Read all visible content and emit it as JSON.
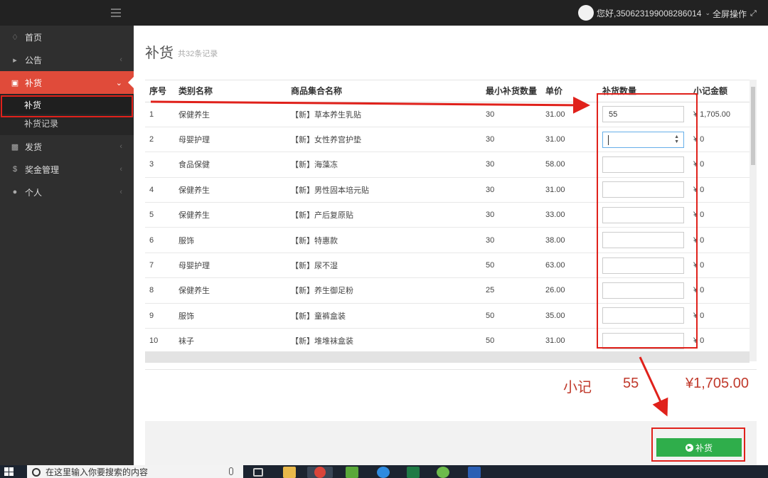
{
  "topbar": {
    "user_greeting": "您好,350623199008286014",
    "fullscreen_label": "全屏操作"
  },
  "sidebar": {
    "items": [
      {
        "label": "首页",
        "icon": "diamond-icon"
      },
      {
        "label": "公告",
        "icon": "bullhorn-icon"
      },
      {
        "label": "补货",
        "icon": "cart-icon",
        "active": true
      },
      {
        "label": "发货",
        "icon": "truck-icon"
      },
      {
        "label": "奖金管理",
        "icon": "dollar-icon"
      },
      {
        "label": "个人",
        "icon": "user-icon"
      }
    ],
    "sub_items": [
      {
        "label": "补货",
        "selected": true
      },
      {
        "label": "补货记录"
      }
    ]
  },
  "page": {
    "title": "补货",
    "count": "共32条记录"
  },
  "table": {
    "headers": [
      "序号",
      "类别名称",
      "商品集合名称",
      "最小补货数量",
      "单价",
      "补货数量",
      "小记金额"
    ],
    "rows": [
      {
        "no": "1",
        "category": "保健养生",
        "product": "【新】草本养生乳贴",
        "min_qty": "30",
        "price": "31.00",
        "qty": "55",
        "subtotal": "¥ 1,705.00"
      },
      {
        "no": "2",
        "category": "母婴护理",
        "product": "【新】女性养宫护垫",
        "min_qty": "30",
        "price": "31.00",
        "qty": "",
        "subtotal": "¥ 0"
      },
      {
        "no": "3",
        "category": "食品保健",
        "product": "【新】海藻冻",
        "min_qty": "30",
        "price": "58.00",
        "qty": "",
        "subtotal": "¥ 0"
      },
      {
        "no": "4",
        "category": "保健养生",
        "product": "【新】男性固本培元贴",
        "min_qty": "30",
        "price": "31.00",
        "qty": "",
        "subtotal": "¥ 0"
      },
      {
        "no": "5",
        "category": "保健养生",
        "product": "【新】产后复原贴",
        "min_qty": "30",
        "price": "33.00",
        "qty": "",
        "subtotal": "¥ 0"
      },
      {
        "no": "6",
        "category": "服饰",
        "product": "【新】特惠款",
        "min_qty": "30",
        "price": "38.00",
        "qty": "",
        "subtotal": "¥ 0"
      },
      {
        "no": "7",
        "category": "母婴护理",
        "product": "【新】尿不湿",
        "min_qty": "50",
        "price": "63.00",
        "qty": "",
        "subtotal": "¥ 0"
      },
      {
        "no": "8",
        "category": "保健养生",
        "product": "【新】养生御足粉",
        "min_qty": "25",
        "price": "26.00",
        "qty": "",
        "subtotal": "¥ 0"
      },
      {
        "no": "9",
        "category": "服饰",
        "product": "【新】童裤盒装",
        "min_qty": "50",
        "price": "35.00",
        "qty": "",
        "subtotal": "¥ 0"
      },
      {
        "no": "10",
        "category": "袜子",
        "product": "【新】堆堆袜盒装",
        "min_qty": "50",
        "price": "31.00",
        "qty": "",
        "subtotal": "¥ 0"
      }
    ]
  },
  "summary": {
    "label": "小记",
    "qty": "55",
    "amount": "¥1,705.00"
  },
  "submit_label": "补货",
  "taskbar": {
    "search_placeholder": "在这里输入你要搜索的内容"
  },
  "colors": {
    "sidebar_active": "#e04b3a",
    "submit_green": "#2fae4b",
    "annotation_red": "#e0211b",
    "summary_red": "#c0392b"
  }
}
